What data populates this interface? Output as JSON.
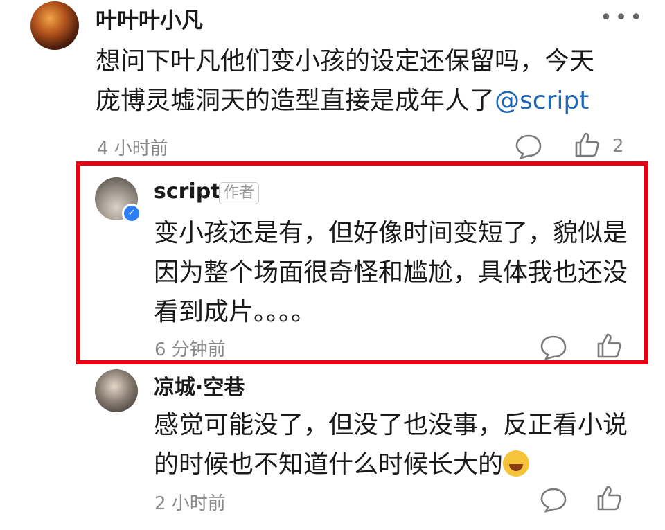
{
  "comments": [
    {
      "username": "叶叶叶小凡",
      "line1": "想问下叶凡他们变小孩的设定还保留吗，今天",
      "line2_text": "庞博灵墟洞天的造型直接是成年人了",
      "mention": "@script",
      "time": "4 小时前",
      "likes": "2"
    },
    {
      "username": "script",
      "badge": "作者",
      "line1": "变小孩还是有，但好像时间变短了，貌似是",
      "line2": "因为整个场面很奇怪和尴尬，具体我也还没",
      "line3": "看到成片。。。。",
      "time": "6 分钟前"
    },
    {
      "username": "凉城·空巷",
      "line1": "感觉可能没了，但没了也没事，反正看小说",
      "line2": "的时候也不知道什么时候长大的",
      "time": "2 小时前"
    }
  ],
  "more_icon": "more-icon",
  "highlight_color": "#e60012",
  "mention_color": "#1f68b8"
}
